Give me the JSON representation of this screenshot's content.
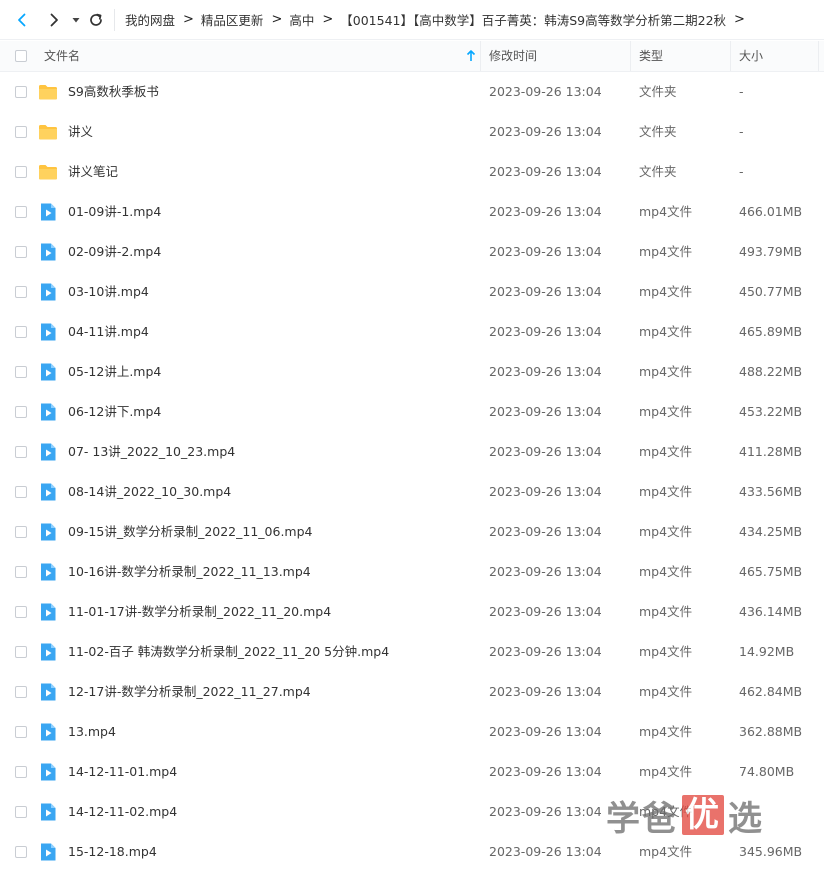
{
  "breadcrumb": [
    "我的网盘",
    "精品区更新",
    "高中",
    "【001541】【高中数学】百子菁英：韩涛S9高等数学分析第二期22秋"
  ],
  "breadcrumb_separator": ">",
  "columns": {
    "name": "文件名",
    "date": "修改时间",
    "type": "类型",
    "size": "大小"
  },
  "files": [
    {
      "name": "S9高数秋季板书",
      "date": "2023-09-26 13:04",
      "type": "文件夹",
      "size": "-",
      "icon": "folder-icon"
    },
    {
      "name": "讲义",
      "date": "2023-09-26 13:04",
      "type": "文件夹",
      "size": "-",
      "icon": "folder-icon"
    },
    {
      "name": "讲义笔记",
      "date": "2023-09-26 13:04",
      "type": "文件夹",
      "size": "-",
      "icon": "folder-icon"
    },
    {
      "name": "01-09讲-1.mp4",
      "date": "2023-09-26 13:04",
      "type": "mp4文件",
      "size": "466.01MB",
      "icon": "video-file-icon"
    },
    {
      "name": "02-09讲-2.mp4",
      "date": "2023-09-26 13:04",
      "type": "mp4文件",
      "size": "493.79MB",
      "icon": "video-file-icon"
    },
    {
      "name": "03-10讲.mp4",
      "date": "2023-09-26 13:04",
      "type": "mp4文件",
      "size": "450.77MB",
      "icon": "video-file-icon"
    },
    {
      "name": "04-11讲.mp4",
      "date": "2023-09-26 13:04",
      "type": "mp4文件",
      "size": "465.89MB",
      "icon": "video-file-icon"
    },
    {
      "name": "05-12讲上.mp4",
      "date": "2023-09-26 13:04",
      "type": "mp4文件",
      "size": "488.22MB",
      "icon": "video-file-icon"
    },
    {
      "name": "06-12讲下.mp4",
      "date": "2023-09-26 13:04",
      "type": "mp4文件",
      "size": "453.22MB",
      "icon": "video-file-icon"
    },
    {
      "name": "07- 13讲_2022_10_23.mp4",
      "date": "2023-09-26 13:04",
      "type": "mp4文件",
      "size": "411.28MB",
      "icon": "video-file-icon"
    },
    {
      "name": "08-14讲_2022_10_30.mp4",
      "date": "2023-09-26 13:04",
      "type": "mp4文件",
      "size": "433.56MB",
      "icon": "video-file-icon"
    },
    {
      "name": "09-15讲_数学分析录制_2022_11_06.mp4",
      "date": "2023-09-26 13:04",
      "type": "mp4文件",
      "size": "434.25MB",
      "icon": "video-file-icon"
    },
    {
      "name": "10-16讲-数学分析录制_2022_11_13.mp4",
      "date": "2023-09-26 13:04",
      "type": "mp4文件",
      "size": "465.75MB",
      "icon": "video-file-icon"
    },
    {
      "name": "11-01-17讲-数学分析录制_2022_11_20.mp4",
      "date": "2023-09-26 13:04",
      "type": "mp4文件",
      "size": "436.14MB",
      "icon": "video-file-icon"
    },
    {
      "name": "11-02-百子 韩涛数学分析录制_2022_11_20 5分钟.mp4",
      "date": "2023-09-26 13:04",
      "type": "mp4文件",
      "size": "14.92MB",
      "icon": "video-file-icon"
    },
    {
      "name": "12-17讲-数学分析录制_2022_11_27.mp4",
      "date": "2023-09-26 13:04",
      "type": "mp4文件",
      "size": "462.84MB",
      "icon": "video-file-icon"
    },
    {
      "name": "13.mp4",
      "date": "2023-09-26 13:04",
      "type": "mp4文件",
      "size": "362.88MB",
      "icon": "video-file-icon"
    },
    {
      "name": "14-12-11-01.mp4",
      "date": "2023-09-26 13:04",
      "type": "mp4文件",
      "size": "74.80MB",
      "icon": "video-file-icon"
    },
    {
      "name": "14-12-11-02.mp4",
      "date": "2023-09-26 13:04",
      "type": "mp4文件",
      "size": "",
      "icon": "video-file-icon"
    },
    {
      "name": "15-12-18.mp4",
      "date": "2023-09-26 13:04",
      "type": "mp4文件",
      "size": "345.96MB",
      "icon": "video-file-icon"
    }
  ],
  "watermark": {
    "part1": "学爸",
    "accent": "优",
    "part2": "选"
  },
  "colors": {
    "accent": "#06a7ff",
    "folder": "#ffc440",
    "video": "#3aa6f2",
    "watermark_accent": "#e2443a"
  }
}
